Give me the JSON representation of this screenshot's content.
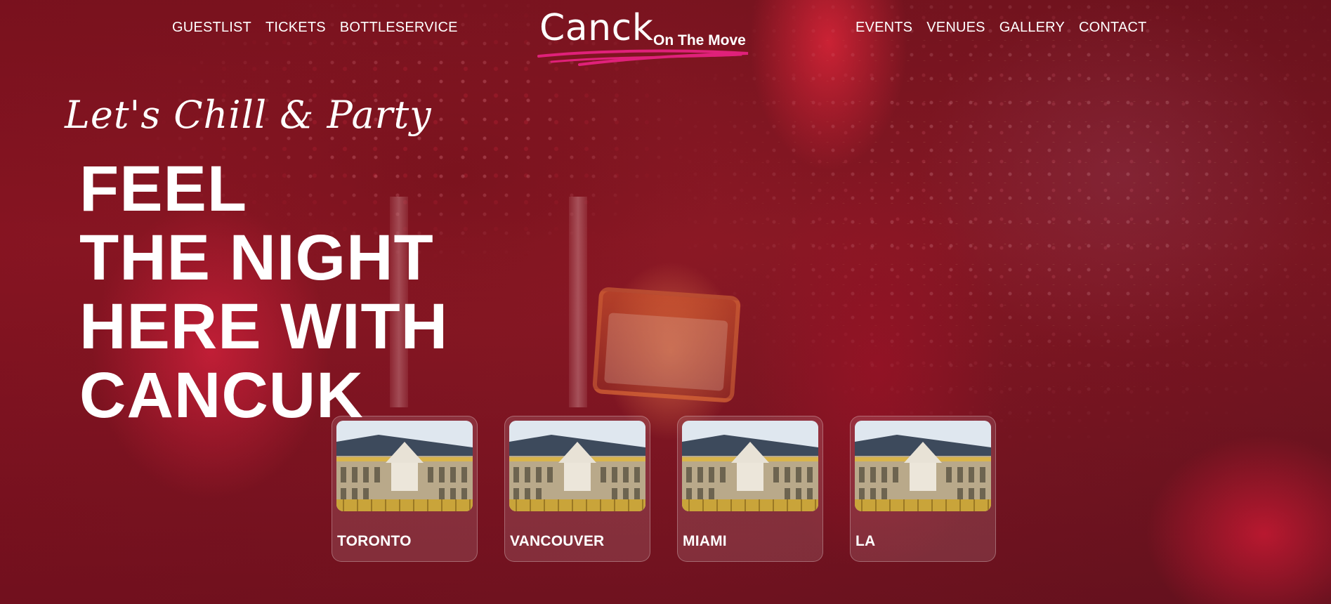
{
  "nav": {
    "left": [
      "GUESTLIST",
      "TICKETS",
      "BOTTLESERVICE"
    ],
    "right": [
      "EVENTS",
      "VENUES",
      "GALLERY",
      "CONTACT"
    ]
  },
  "logo": {
    "main": "Canck",
    "sub": "On The Move",
    "underline_color": "#e0217a"
  },
  "hero": {
    "tagline": "Let's Chill & Party",
    "headline": [
      "FEEL",
      "THE NIGHT",
      "HERE WITH",
      "CANCUK"
    ]
  },
  "cities": [
    {
      "name": "TORONTO",
      "image": "palace-photo"
    },
    {
      "name": "VANCOUVER",
      "image": "palace-photo"
    },
    {
      "name": "MIAMI",
      "image": "palace-photo"
    },
    {
      "name": "LA",
      "image": "palace-photo"
    }
  ],
  "colors": {
    "background": "#8e1a26",
    "accent": "#e0217a",
    "text": "#ffffff"
  }
}
